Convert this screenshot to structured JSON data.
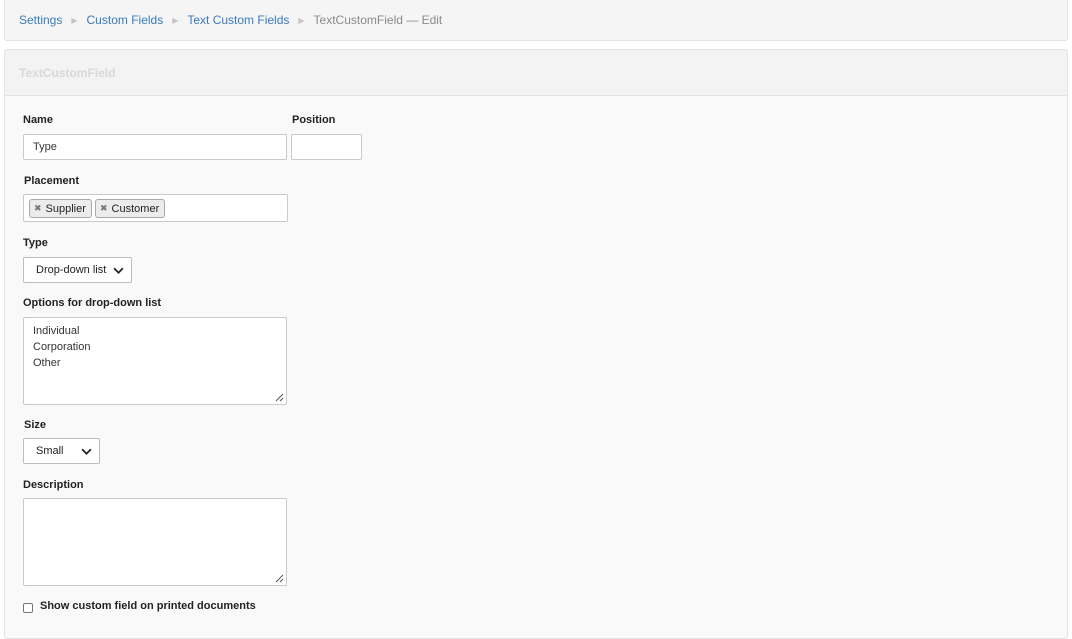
{
  "breadcrumb": {
    "items": [
      "Settings",
      "Custom Fields",
      "Text Custom Fields"
    ],
    "current": "TextCustomField — Edit"
  },
  "panel": {
    "title": "TextCustomField"
  },
  "form": {
    "name": {
      "label": "Name",
      "value": "Type"
    },
    "position": {
      "label": "Position",
      "value": ""
    },
    "placement": {
      "label": "Placement",
      "tags": [
        "Supplier",
        "Customer"
      ]
    },
    "type": {
      "label": "Type",
      "selected": "Drop-down list"
    },
    "options": {
      "label": "Options for drop-down list",
      "lines": [
        "Individual",
        "Corporation",
        "Other"
      ]
    },
    "size": {
      "label": "Size",
      "selected": "Small"
    },
    "description": {
      "label": "Description",
      "value": ""
    },
    "show_on_print": {
      "label": "Show custom field on printed documents",
      "checked": false
    }
  }
}
